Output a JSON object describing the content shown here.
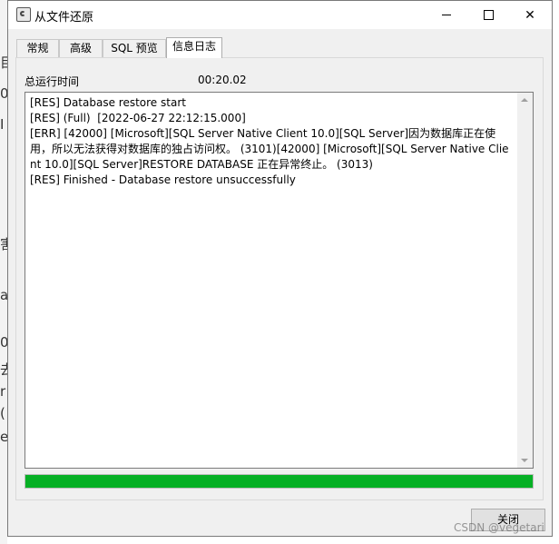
{
  "window": {
    "title": "从文件还原",
    "icon": "restore-app-icon",
    "controls": {
      "minimize": "minimize-icon",
      "maximize": "maximize-icon",
      "close": "✕"
    }
  },
  "tabs": [
    {
      "label": "常规",
      "active": false
    },
    {
      "label": "高级",
      "active": false
    },
    {
      "label": "SQL 预览",
      "active": false
    },
    {
      "label": "信息日志",
      "active": true
    }
  ],
  "runtime": {
    "label": "总运行时间",
    "value": "00:20.02"
  },
  "log": {
    "lines": [
      "[RES] Database restore start",
      "[RES] (Full)  [2022-06-27 22:12:15.000]",
      "[ERR] [42000] [Microsoft][SQL Server Native Client 10.0][SQL Server]因为数据库正在使用，所以无法获得对数据库的独占访问权。 (3101)[42000] [Microsoft][SQL Server Native Client 10.0][SQL Server]RESTORE DATABASE 正在异常终止。 (3013)",
      "[RES] Finished - Database restore unsuccessfully"
    ]
  },
  "progress": {
    "percent": 100,
    "color": "#06b025"
  },
  "buttons": {
    "close": "关闭"
  },
  "watermark": "CSDN @vegetari",
  "background_fragments": [
    "目",
    "0",
    "I",
    "害",
    "a",
    "0",
    "去",
    "r",
    "(",
    "e"
  ]
}
